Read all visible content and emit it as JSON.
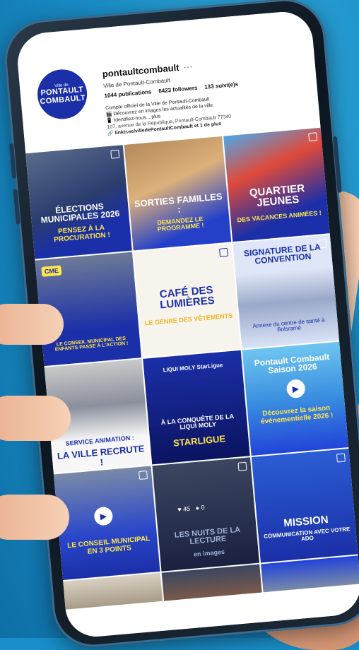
{
  "profile": {
    "avatar_small": "Ville de",
    "avatar_line1": "PONTAULT",
    "avatar_line2": "COMBAULT",
    "username": "pontaultcombault",
    "more": "···",
    "full_name": "Ville de Pontault-Combault",
    "publications": "1044 publications",
    "followers": "6423 followers",
    "following": "133 suivi(e)s",
    "bio_line1": "Compte officiel de la Ville de Pontault-Combault",
    "bio_line2": "🎬 Découvrez en images les actualités de la ville",
    "bio_line3": "📱 Identifiez-nous... plus",
    "address": "107, avenue de la République, Pontault-Combault 77340",
    "link": "🔗 linktr.ee/villedePontaultCombault et 1 de plus"
  },
  "tiles": {
    "t1_title": "ÉLECTIONS MUNICIPALES 2026",
    "t1_sub": "PENSEZ À LA PROCURATION !",
    "t2_title": "SORTIES FAMILLES :",
    "t2_sub": "DEMANDEZ LE PROGRAMME !",
    "t3_title": "QUARTIER JEUNES",
    "t3_sub": "DES VACANCES ANIMÉES !",
    "t4_badge": "CME",
    "t4_sub": "LE CONSEIL MUNICIPAL DES ENFANTS PASSE À L'ACTION !",
    "t5_title": "CAFÉ DES LUMIÈRES",
    "t5_sub": "LE GENRE DES VÊTEMENTS",
    "t6_title": "SIGNATURE DE LA CONVENTION",
    "t6_sub": "Annexe du centre de santé à Bolsramé",
    "t7_title": "SERVICE ANIMATION :",
    "t7_sub": "LA VILLE RECRUTE !",
    "t8_badge": "LIQUI MOLY StarLigue",
    "t8_title": "À LA CONQUÊTE DE LA LIQUI MOLY",
    "t8_sub": "STARLIGUE",
    "t9_title": "Pontault Combault Saison 2026",
    "t9_sub": "Découvrez la saison événementielle 2026 !",
    "t10_title": "LE CONSEIL MUNICIPAL EN 3 POINTS",
    "t11_likes": "45",
    "t11_comments": "0",
    "t11_title": "LES NUITS DE LA LECTURE",
    "t11_sub": "en images",
    "t12_title": "MISSION",
    "t12_sub": "COMMUNICATION AVEC VOTRE ADO"
  }
}
